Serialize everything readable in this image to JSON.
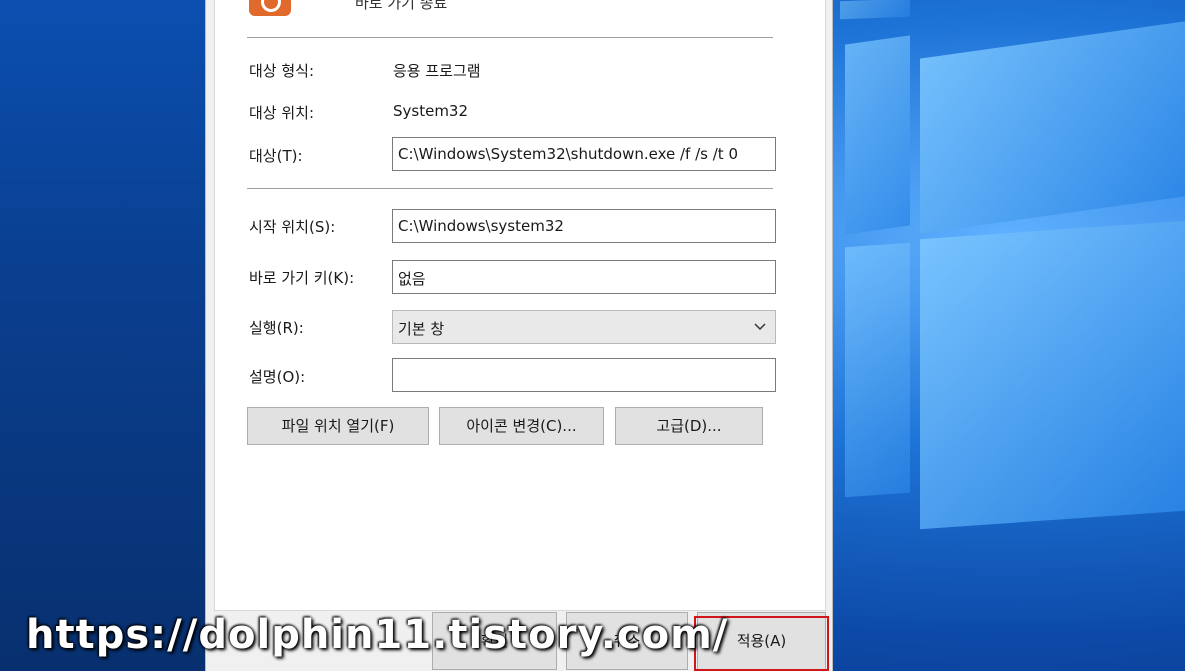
{
  "dialog": {
    "title_fragment": "바로 가기 종료",
    "fields": {
      "target_type": {
        "label": "대상 형식:",
        "value": "응용 프로그램"
      },
      "target_location": {
        "label": "대상 위치:",
        "value": "System32"
      },
      "target": {
        "label": "대상(T):",
        "value": "C:\\Windows\\System32\\shutdown.exe /f /s /t 0"
      },
      "start_in": {
        "label": "시작 위치(S):",
        "value": "C:\\Windows\\system32"
      },
      "shortcut_key": {
        "label": "바로 가기 키(K):",
        "value": "없음"
      },
      "run": {
        "label": "실행(R):",
        "value": "기본 창"
      },
      "comment": {
        "label": "설명(O):",
        "value": ""
      }
    },
    "buttons": {
      "open_location": "파일 위치 열기(F)",
      "change_icon": "아이콘 변경(C)...",
      "advanced": "고급(D)..."
    },
    "footer": {
      "ok": "확인",
      "cancel": "취소",
      "apply": "적용(A)"
    }
  },
  "watermark": "https://dolphin11.tistory.com/",
  "colors": {
    "highlight": "#d0161b",
    "app_icon": "#e06a2c"
  },
  "icons": {
    "app": "shutdown-app-icon",
    "dropdown": "chevron-down-icon"
  }
}
